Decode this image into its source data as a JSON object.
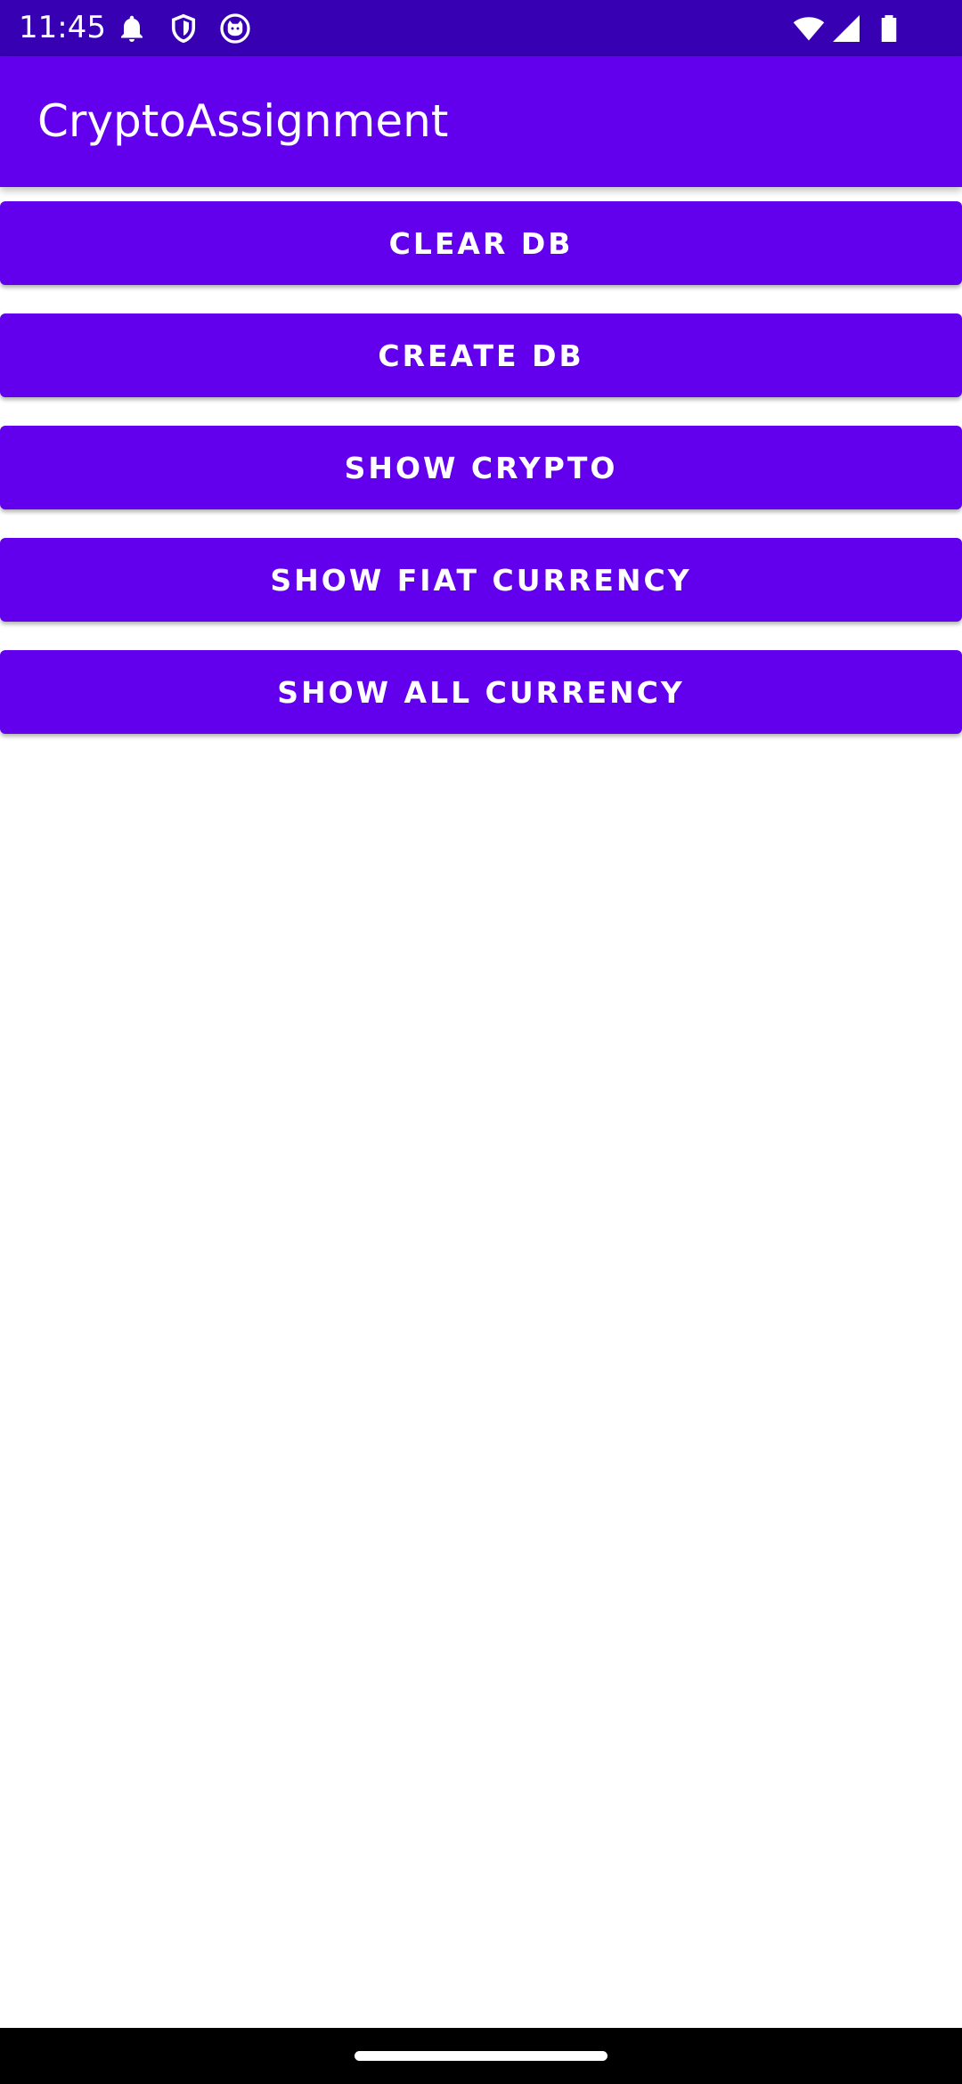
{
  "status_bar": {
    "time": "11:45",
    "icons": [
      "notification-bell-icon",
      "shield-icon",
      "cat-face-icon",
      "wifi-icon",
      "cellular-signal-icon",
      "battery-icon"
    ]
  },
  "app_bar": {
    "title": "CryptoAssignment"
  },
  "buttons": [
    {
      "label": "CLEAR DB"
    },
    {
      "label": "CREATE DB"
    },
    {
      "label": "SHOW CRYPTO"
    },
    {
      "label": "SHOW FIAT CURRENCY"
    },
    {
      "label": "SHOW ALL CURRENCY"
    }
  ],
  "colors": {
    "status_bar": "#3700b3",
    "primary": "#6200ee",
    "on_primary": "#ffffff",
    "background": "#ffffff",
    "nav_bar": "#000000"
  }
}
